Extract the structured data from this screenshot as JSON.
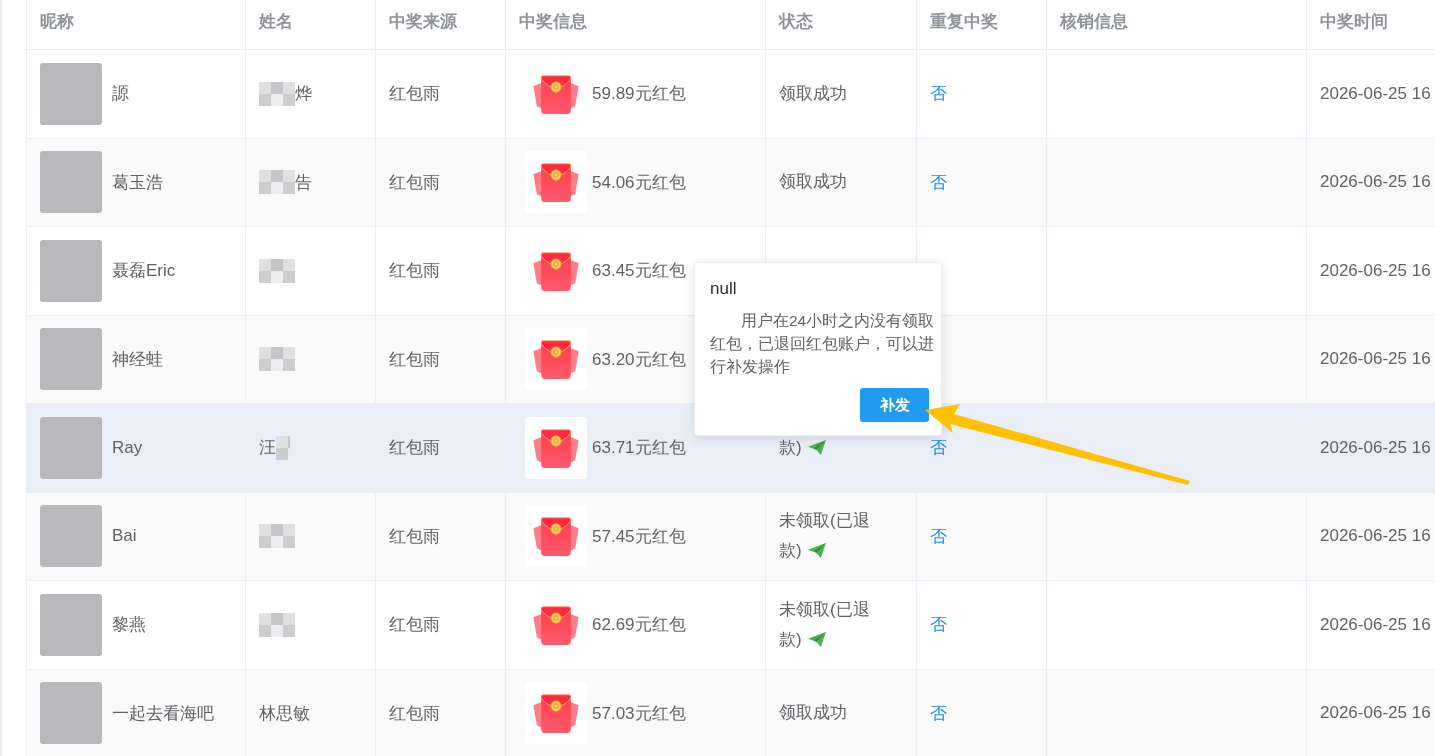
{
  "table": {
    "columns": [
      "昵称",
      "姓名",
      "中奖来源",
      "中奖信息",
      "状态",
      "重复中奖",
      "核销信息",
      "中奖时间"
    ],
    "rows": [
      {
        "nickname": "謜",
        "name_parts": [
          {
            "kind": "mask"
          },
          {
            "kind": "text",
            "text": "烨"
          }
        ],
        "source": "红包雨",
        "prize": "59.89元红包",
        "status": {
          "text": "领取成功",
          "resend_icon": false
        },
        "repeat": "否",
        "time": "2026-06-25 16",
        "hovered": false
      },
      {
        "nickname": "葛玉浩",
        "name_parts": [
          {
            "kind": "mask"
          },
          {
            "kind": "text",
            "text": "告"
          }
        ],
        "source": "红包雨",
        "prize": "54.06元红包",
        "status": {
          "text": "领取成功",
          "resend_icon": false
        },
        "repeat": "否",
        "time": "2026-06-25 16",
        "hovered": false
      },
      {
        "nickname": "聂磊Eric",
        "name_parts": [
          {
            "kind": "mask"
          }
        ],
        "source": "红包雨",
        "prize": "63.45元红包",
        "time": "2026-06-25 16",
        "hovered": false
      },
      {
        "nickname": "神经蛙",
        "name_parts": [
          {
            "kind": "mask"
          }
        ],
        "source": "红包雨",
        "prize": "63.20元红包",
        "time": "2026-06-25 16",
        "hovered": false
      },
      {
        "nickname": "Ray",
        "name_parts": [
          {
            "kind": "text",
            "text": "汪"
          },
          {
            "kind": "mask"
          }
        ],
        "source": "红包雨",
        "prize": "63.71元红包",
        "status": {
          "text": "款)",
          "resend_icon": true
        },
        "repeat": "否",
        "time": "2026-06-25 16",
        "hovered": true
      },
      {
        "nickname": "Bai",
        "name_parts": [
          {
            "kind": "mask"
          }
        ],
        "source": "红包雨",
        "prize": "57.45元红包",
        "status": {
          "text": "未领取(已退款)",
          "resend_icon": true
        },
        "repeat": "否",
        "time": "2026-06-25 16",
        "hovered": false
      },
      {
        "nickname": "黎燕",
        "name_parts": [
          {
            "kind": "mask"
          }
        ],
        "source": "红包雨",
        "prize": "62.69元红包",
        "status": {
          "text": "未领取(已退款)",
          "resend_icon": true
        },
        "repeat": "否",
        "time": "2026-06-25 16",
        "hovered": false
      },
      {
        "nickname": "一起去看海吧",
        "name_parts": [
          {
            "kind": "text",
            "text": "林思敏"
          }
        ],
        "source": "红包雨",
        "prize": "57.03元红包",
        "status": {
          "text": "领取成功",
          "resend_icon": false
        },
        "repeat": "否",
        "time": "2026-06-25 16",
        "hovered": false
      }
    ]
  },
  "popover": {
    "title": "null",
    "message": "用户在24小时之内没有领取红包，已退回红包账户，可以进行补发操作",
    "button": "补发"
  }
}
